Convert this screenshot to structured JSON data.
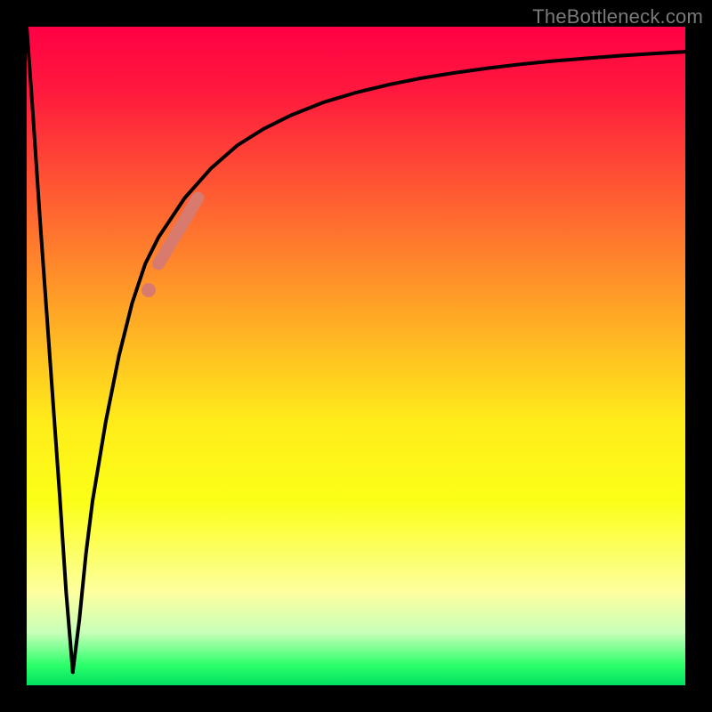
{
  "watermark": "TheBottleneck.com",
  "colors": {
    "frame": "#000000",
    "curve_stroke": "#000000",
    "highlight_stroke": "#d97a6e",
    "gradient_top": "#ff0044",
    "gradient_bottom": "#00e060"
  },
  "chart_data": {
    "type": "line",
    "title": "",
    "xlabel": "",
    "ylabel": "",
    "xlim": [
      0,
      100
    ],
    "ylim": [
      0,
      100
    ],
    "grid": false,
    "legend": false,
    "series": [
      {
        "name": "left-descent",
        "x": [
          0,
          1,
          2,
          3,
          4,
          5,
          6,
          7
        ],
        "values": [
          100,
          86,
          71,
          57,
          43,
          29,
          14,
          2
        ]
      },
      {
        "name": "main-curve",
        "x": [
          7,
          8,
          9,
          10,
          12,
          14,
          16,
          18,
          20,
          24,
          28,
          32,
          36,
          40,
          45,
          50,
          55,
          60,
          65,
          70,
          75,
          80,
          85,
          90,
          95,
          100
        ],
        "values": [
          2,
          10,
          20,
          28,
          40,
          50,
          58,
          64,
          68,
          74,
          78.5,
          82,
          84.5,
          86.5,
          88.5,
          90,
          91.2,
          92.2,
          93,
          93.7,
          94.3,
          94.8,
          95.2,
          95.6,
          95.9,
          96.2
        ]
      }
    ],
    "highlights": [
      {
        "name": "highlight-dot",
        "x": 18.5,
        "y": 60
      },
      {
        "name": "highlight-segment",
        "x": [
          20,
          26
        ],
        "values": [
          64,
          74
        ]
      }
    ]
  }
}
